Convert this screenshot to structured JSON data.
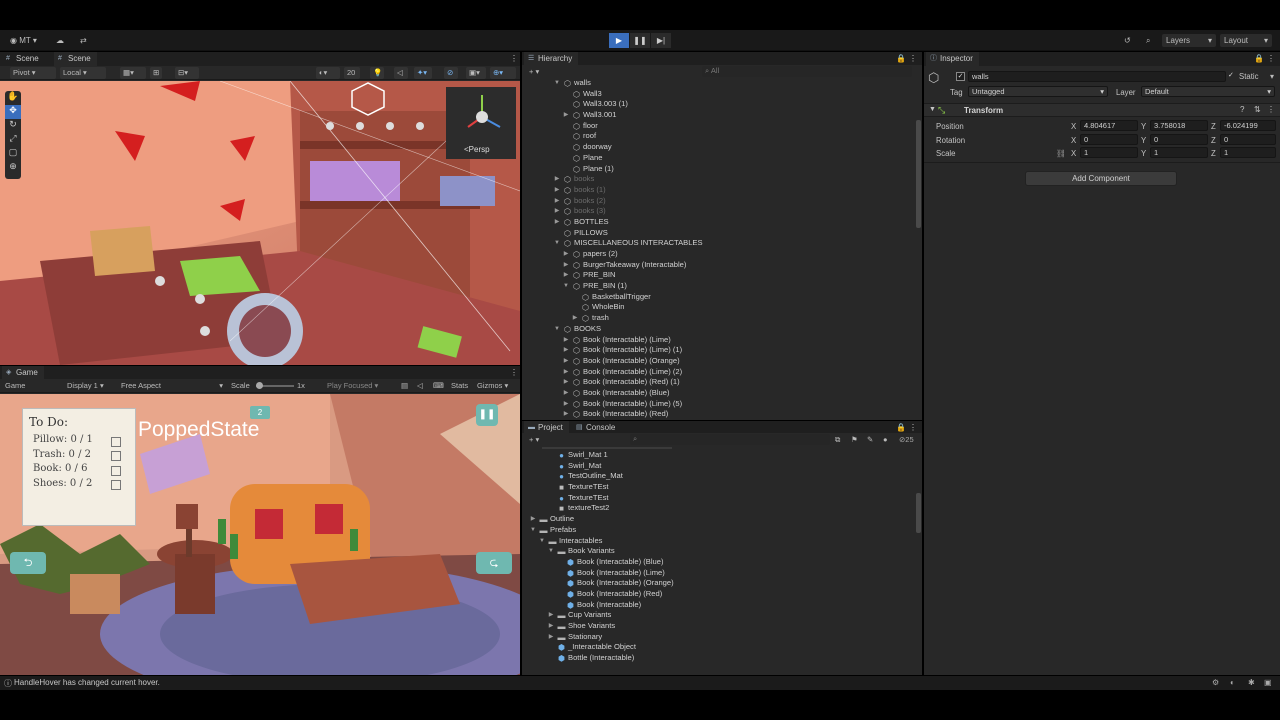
{
  "topbar": {
    "account": "MT",
    "layers_label": "Layers",
    "layout_label": "Layout"
  },
  "scene": {
    "tabs": [
      "Scene",
      "Scene"
    ],
    "pivot": "Pivot",
    "local": "Local",
    "grid_value": "20",
    "persp_label": "<Persp"
  },
  "game": {
    "tab": "Game",
    "view": "Game",
    "display": "Display 1",
    "aspect": "Free Aspect",
    "scale_label": "Scale",
    "scale_value": "1x",
    "play_focused": "Play Focused",
    "stats": "Stats",
    "gizmos": "Gizmos",
    "overlay_text": "PoppedState",
    "todo_title": "To Do:",
    "todo_items": [
      "Pillow: 0 / 1",
      "Trash: 0 / 2",
      "Book: 0 / 6",
      "Shoes: 0 / 2"
    ],
    "badge": "2"
  },
  "hierarchy": {
    "tab": "Hierarchy",
    "search_placeholder": "All",
    "rows": [
      {
        "label": "walls",
        "depth": 3,
        "arrow": "▼",
        "dim": false
      },
      {
        "label": "Wall3",
        "depth": 4,
        "arrow": "",
        "dim": false
      },
      {
        "label": "Wall3.003 (1)",
        "depth": 4,
        "arrow": "",
        "dim": false
      },
      {
        "label": "Wall3.001",
        "depth": 4,
        "arrow": "▶",
        "dim": false
      },
      {
        "label": "floor",
        "depth": 4,
        "arrow": "",
        "dim": false
      },
      {
        "label": "roof",
        "depth": 4,
        "arrow": "",
        "dim": false
      },
      {
        "label": "doorway",
        "depth": 4,
        "arrow": "",
        "dim": false
      },
      {
        "label": "Plane",
        "depth": 4,
        "arrow": "",
        "dim": false
      },
      {
        "label": "Plane (1)",
        "depth": 4,
        "arrow": "",
        "dim": false
      },
      {
        "label": "books",
        "depth": 3,
        "arrow": "▶",
        "dim": true
      },
      {
        "label": "books (1)",
        "depth": 3,
        "arrow": "▶",
        "dim": true
      },
      {
        "label": "books (2)",
        "depth": 3,
        "arrow": "▶",
        "dim": true
      },
      {
        "label": "books (3)",
        "depth": 3,
        "arrow": "▶",
        "dim": true
      },
      {
        "label": "BOTTLES",
        "depth": 3,
        "arrow": "▶",
        "dim": false
      },
      {
        "label": "PILLOWS",
        "depth": 3,
        "arrow": "",
        "dim": false
      },
      {
        "label": "MISCELLANEOUS INTERACTABLES",
        "depth": 3,
        "arrow": "▼",
        "dim": false
      },
      {
        "label": "papers (2)",
        "depth": 4,
        "arrow": "▶",
        "dim": false
      },
      {
        "label": "BurgerTakeaway (Interactable)",
        "depth": 4,
        "arrow": "▶",
        "dim": false
      },
      {
        "label": "PRE_BIN",
        "depth": 4,
        "arrow": "▶",
        "dim": false
      },
      {
        "label": "PRE_BIN (1)",
        "depth": 4,
        "arrow": "▼",
        "dim": false
      },
      {
        "label": "BasketballTrigger",
        "depth": 5,
        "arrow": "",
        "dim": false
      },
      {
        "label": "WholeBin",
        "depth": 5,
        "arrow": "",
        "dim": false
      },
      {
        "label": "trash",
        "depth": 5,
        "arrow": "▶",
        "dim": false
      },
      {
        "label": "BOOKS",
        "depth": 3,
        "arrow": "▼",
        "dim": false
      },
      {
        "label": "Book (Interactable) (Lime)",
        "depth": 4,
        "arrow": "▶",
        "dim": false
      },
      {
        "label": "Book (Interactable) (Lime) (1)",
        "depth": 4,
        "arrow": "▶",
        "dim": false
      },
      {
        "label": "Book (Interactable) (Orange)",
        "depth": 4,
        "arrow": "▶",
        "dim": false
      },
      {
        "label": "Book (Interactable) (Lime) (2)",
        "depth": 4,
        "arrow": "▶",
        "dim": false
      },
      {
        "label": "Book (Interactable) (Red) (1)",
        "depth": 4,
        "arrow": "▶",
        "dim": false
      },
      {
        "label": "Book (Interactable) (Blue)",
        "depth": 4,
        "arrow": "▶",
        "dim": false
      },
      {
        "label": "Book (Interactable) (Lime) (5)",
        "depth": 4,
        "arrow": "▶",
        "dim": false
      },
      {
        "label": "Book (Interactable) (Red)",
        "depth": 4,
        "arrow": "▶",
        "dim": false
      }
    ]
  },
  "project": {
    "tabs": [
      "Project",
      "Console"
    ],
    "count": "25",
    "rows": [
      {
        "label": "Swirl_Mat 1",
        "depth": 3,
        "icon": "mat"
      },
      {
        "label": "Swirl_Mat",
        "depth": 3,
        "icon": "mat"
      },
      {
        "label": "TestOutline_Mat",
        "depth": 3,
        "icon": "mat"
      },
      {
        "label": "TextureTEst",
        "depth": 3,
        "icon": "tex"
      },
      {
        "label": "TextureTEst",
        "depth": 3,
        "icon": "mat"
      },
      {
        "label": "textureTest2",
        "depth": 3,
        "icon": "tex"
      },
      {
        "label": "Outline",
        "depth": 1,
        "icon": "folder",
        "arrow": "▶"
      },
      {
        "label": "Prefabs",
        "depth": 1,
        "icon": "folder",
        "arrow": "▼"
      },
      {
        "label": "Interactables",
        "depth": 2,
        "icon": "folder",
        "arrow": "▼"
      },
      {
        "label": "Book Variants",
        "depth": 3,
        "icon": "folder",
        "arrow": "▼"
      },
      {
        "label": "Book (Interactable) (Blue)",
        "depth": 4,
        "icon": "prefab"
      },
      {
        "label": "Book (Interactable) (Lime)",
        "depth": 4,
        "icon": "prefab"
      },
      {
        "label": "Book (Interactable) (Orange)",
        "depth": 4,
        "icon": "prefab"
      },
      {
        "label": "Book (Interactable) (Red)",
        "depth": 4,
        "icon": "prefab"
      },
      {
        "label": "Book (Interactable)",
        "depth": 4,
        "icon": "prefab"
      },
      {
        "label": "Cup Variants",
        "depth": 3,
        "icon": "folder",
        "arrow": "▶"
      },
      {
        "label": "Shoe Variants",
        "depth": 3,
        "icon": "folder",
        "arrow": "▶"
      },
      {
        "label": "Stationary",
        "depth": 3,
        "icon": "folder",
        "arrow": "▶"
      },
      {
        "label": "_Interactable Object",
        "depth": 3,
        "icon": "prefab"
      },
      {
        "label": "Bottle (Interactable)",
        "depth": 3,
        "icon": "prefab"
      }
    ]
  },
  "inspector": {
    "tab": "Inspector",
    "object_name": "walls",
    "static_label": "Static",
    "tag_label": "Tag",
    "tag_value": "Untagged",
    "layer_label": "Layer",
    "layer_value": "Default",
    "component": "Transform",
    "position_label": "Position",
    "rotation_label": "Rotation",
    "scale_label": "Scale",
    "position": {
      "x": "4.804617",
      "y": "3.758018",
      "z": "-6.024199"
    },
    "rotation": {
      "x": "0",
      "y": "0",
      "z": "0"
    },
    "scale": {
      "x": "1",
      "y": "1",
      "z": "1"
    },
    "add_component": "Add Component"
  },
  "status": {
    "message": "HandleHover has changed current hover."
  },
  "colors": {
    "accent": "#3a6ebd",
    "panel": "#282828",
    "toolbar": "#1f1f1f"
  }
}
